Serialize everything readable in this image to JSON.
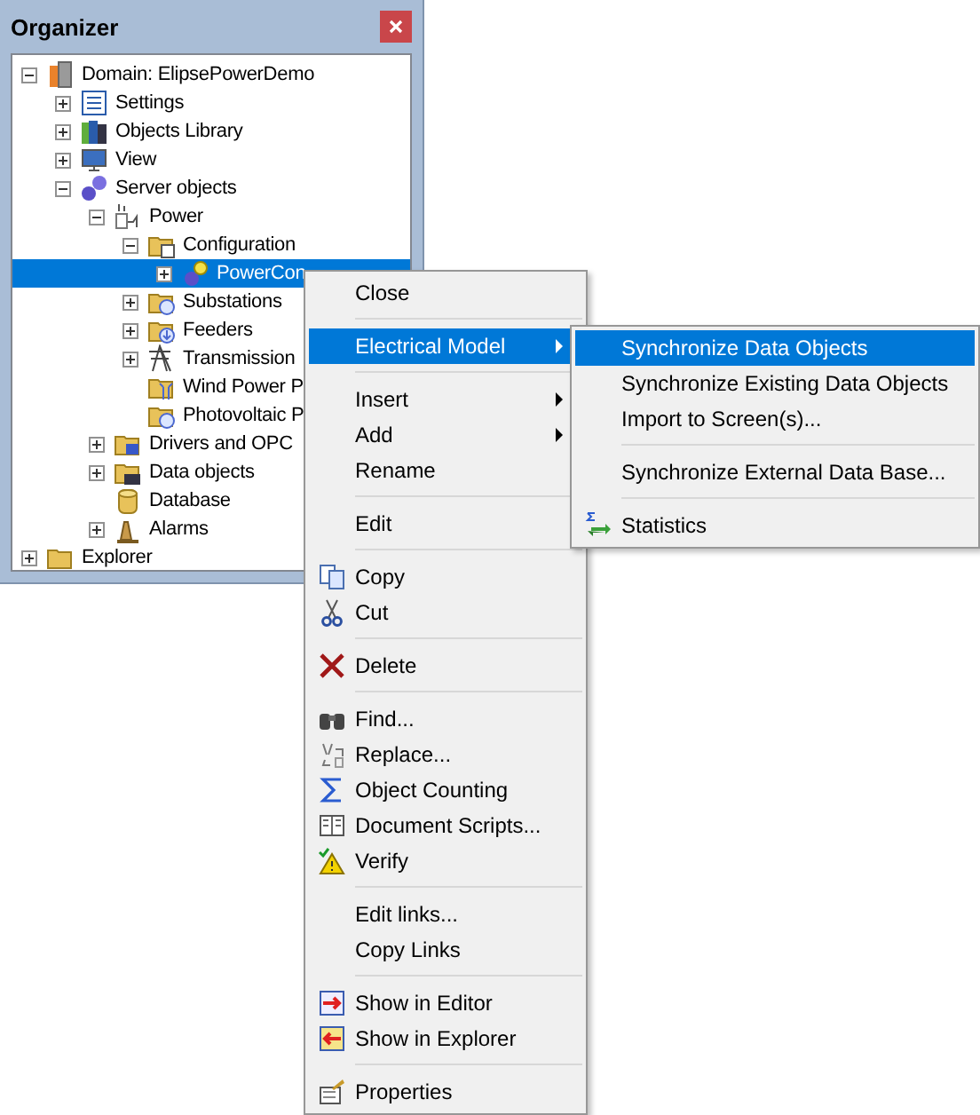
{
  "panel": {
    "title": "Organizer"
  },
  "tree": [
    {
      "label": "Domain: ElipsePowerDemo",
      "expanded": true,
      "selected": false,
      "children": [
        {
          "label": "Settings",
          "expanded": false,
          "selected": false
        },
        {
          "label": "Objects Library",
          "expanded": false,
          "selected": false
        },
        {
          "label": "View",
          "expanded": false,
          "selected": false
        },
        {
          "label": "Server objects",
          "expanded": true,
          "selected": false,
          "children": [
            {
              "label": "Power",
              "expanded": true,
              "selected": false,
              "children": [
                {
                  "label": "Configuration",
                  "expanded": true,
                  "selected": false,
                  "children": [
                    {
                      "label": "PowerCon",
                      "expanded": false,
                      "selected": true
                    }
                  ]
                },
                {
                  "label": "Substations",
                  "expanded": false,
                  "selected": false
                },
                {
                  "label": "Feeders",
                  "expanded": false,
                  "selected": false
                },
                {
                  "label": "Transmission",
                  "expanded": false,
                  "selected": false
                },
                {
                  "label": "Wind Power P",
                  "selected": false
                },
                {
                  "label": "Photovoltaic P",
                  "selected": false
                }
              ]
            },
            {
              "label": "Drivers and OPC",
              "expanded": false,
              "selected": false
            },
            {
              "label": "Data objects",
              "expanded": false,
              "selected": false
            },
            {
              "label": "Database",
              "selected": false
            },
            {
              "label": "Alarms",
              "expanded": false,
              "selected": false
            }
          ]
        }
      ]
    },
    {
      "label": "Explorer",
      "expanded": false,
      "selected": false
    }
  ],
  "context_menu": {
    "items": [
      {
        "kind": "item",
        "label": "Close",
        "selected": false
      },
      {
        "kind": "separator"
      },
      {
        "kind": "item",
        "label": "Electrical Model",
        "submenu": true,
        "selected": true
      },
      {
        "kind": "separator"
      },
      {
        "kind": "item",
        "label": "Insert",
        "submenu": true,
        "selected": false
      },
      {
        "kind": "item",
        "label": "Add",
        "submenu": true,
        "selected": false
      },
      {
        "kind": "item",
        "label": "Rename",
        "selected": false
      },
      {
        "kind": "separator"
      },
      {
        "kind": "item",
        "label": "Edit",
        "selected": false
      },
      {
        "kind": "separator"
      },
      {
        "kind": "item",
        "label": "Copy",
        "selected": false
      },
      {
        "kind": "item",
        "label": "Cut",
        "selected": false
      },
      {
        "kind": "separator"
      },
      {
        "kind": "item",
        "label": "Delete",
        "selected": false
      },
      {
        "kind": "separator"
      },
      {
        "kind": "item",
        "label": "Find...",
        "selected": false
      },
      {
        "kind": "item",
        "label": "Replace...",
        "selected": false
      },
      {
        "kind": "item",
        "label": "Object Counting",
        "selected": false
      },
      {
        "kind": "item",
        "label": "Document Scripts...",
        "selected": false
      },
      {
        "kind": "item",
        "label": "Verify",
        "selected": false
      },
      {
        "kind": "separator"
      },
      {
        "kind": "item",
        "label": "Edit links...",
        "selected": false
      },
      {
        "kind": "item",
        "label": "Copy Links",
        "selected": false
      },
      {
        "kind": "separator"
      },
      {
        "kind": "item",
        "label": "Show in Editor",
        "selected": false
      },
      {
        "kind": "item",
        "label": "Show in Explorer",
        "selected": false
      },
      {
        "kind": "separator"
      },
      {
        "kind": "item",
        "label": "Properties",
        "selected": false
      }
    ]
  },
  "submenu": {
    "items": [
      {
        "kind": "item",
        "label": "Synchronize Data Objects",
        "selected": true
      },
      {
        "kind": "item",
        "label": "Synchronize Existing Data Objects",
        "selected": false
      },
      {
        "kind": "item",
        "label": "Import to Screen(s)...",
        "selected": false
      },
      {
        "kind": "separator"
      },
      {
        "kind": "item",
        "label": "Synchronize External Data Base...",
        "selected": false
      },
      {
        "kind": "separator"
      },
      {
        "kind": "item",
        "label": "Statistics",
        "selected": false
      }
    ]
  }
}
